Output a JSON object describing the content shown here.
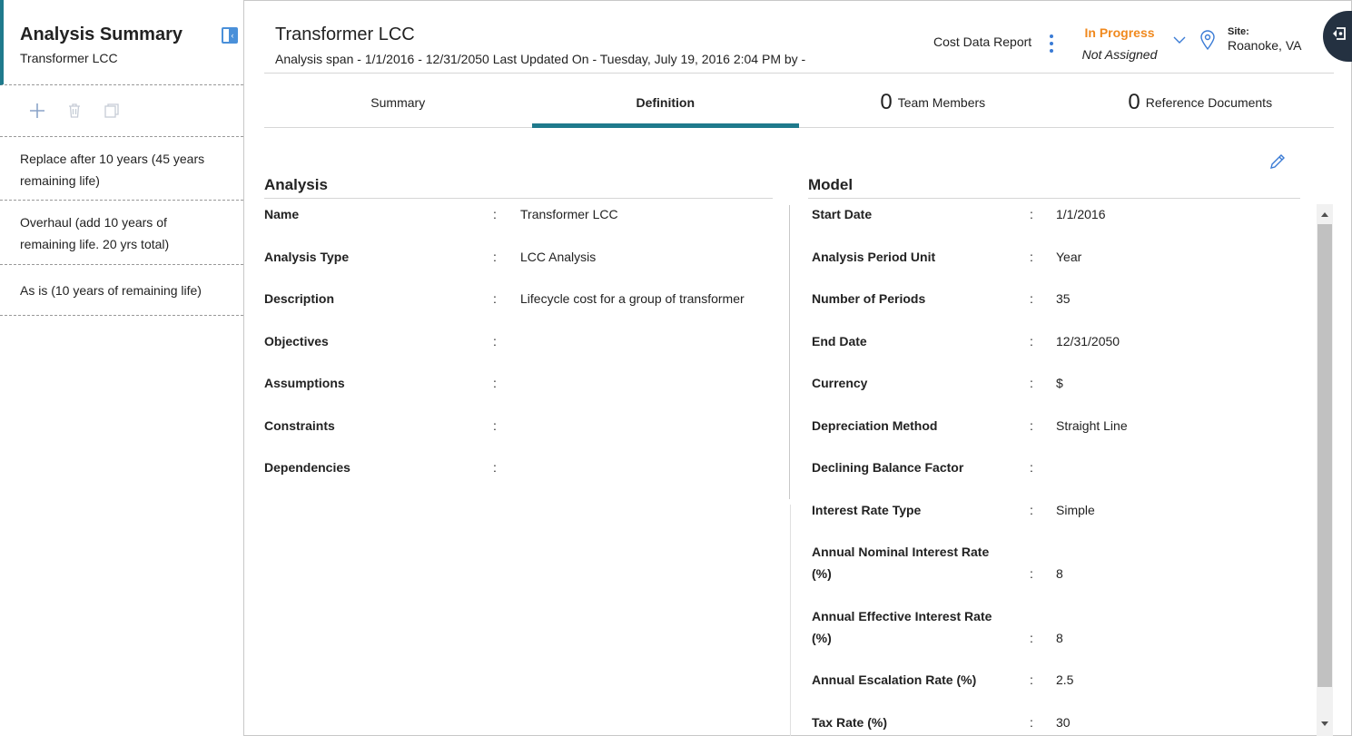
{
  "sidebar": {
    "title": "Analysis Summary",
    "subtitle": "Transformer LCC",
    "items": [
      {
        "label": "Replace after 10 years (45 years remaining life)"
      },
      {
        "label": "Overhaul (add 10 years of remaining life. 20 yrs total)"
      },
      {
        "label": "As is (10 years of remaining life)"
      }
    ]
  },
  "header": {
    "title": "Transformer LCC",
    "span": "Analysis span - 1/1/2016 - 12/31/2050 Last Updated On - Tuesday, July 19, 2016 2:04 PM by -",
    "report_label": "Cost Data Report",
    "status": "In Progress",
    "assigned": "Not Assigned",
    "site_label": "Site:",
    "site_value": "Roanoke, VA"
  },
  "tabs": [
    {
      "count": "",
      "label": "Summary"
    },
    {
      "count": "",
      "label": "Definition"
    },
    {
      "count": "0",
      "label": "Team Members"
    },
    {
      "count": "0",
      "label": "Reference Documents"
    }
  ],
  "analysis": {
    "heading": "Analysis",
    "fields": [
      {
        "label": "Name",
        "value": "Transformer LCC"
      },
      {
        "label": "Analysis Type",
        "value": "LCC Analysis"
      },
      {
        "label": "Description",
        "value": "Lifecycle cost for a group of transformer"
      },
      {
        "label": "Objectives",
        "value": ""
      },
      {
        "label": "Assumptions",
        "value": ""
      },
      {
        "label": "Constraints",
        "value": ""
      },
      {
        "label": "Dependencies",
        "value": ""
      }
    ]
  },
  "model": {
    "heading": "Model",
    "fields": [
      {
        "label": "Start Date",
        "value": "1/1/2016"
      },
      {
        "label": "Analysis Period Unit",
        "value": "Year"
      },
      {
        "label": "Number of Periods",
        "value": "35"
      },
      {
        "label": "End Date",
        "value": "12/31/2050"
      },
      {
        "label": "Currency",
        "value": "$"
      },
      {
        "label": "Depreciation Method",
        "value": "Straight Line"
      },
      {
        "label": "Declining Balance Factor",
        "value": ""
      },
      {
        "label": "Interest Rate Type",
        "value": "Simple"
      },
      {
        "label": "Annual Nominal Interest Rate (%)",
        "value": "8"
      },
      {
        "label": "Annual Effective Interest Rate (%)",
        "value": "8"
      },
      {
        "label": "Annual Escalation Rate (%)",
        "value": "2.5"
      },
      {
        "label": "Tax Rate (%)",
        "value": "30"
      }
    ]
  },
  "colors": {
    "accent": "#1f7a8c",
    "status": "#f0891e",
    "icon_blue": "#3a7bd5"
  }
}
